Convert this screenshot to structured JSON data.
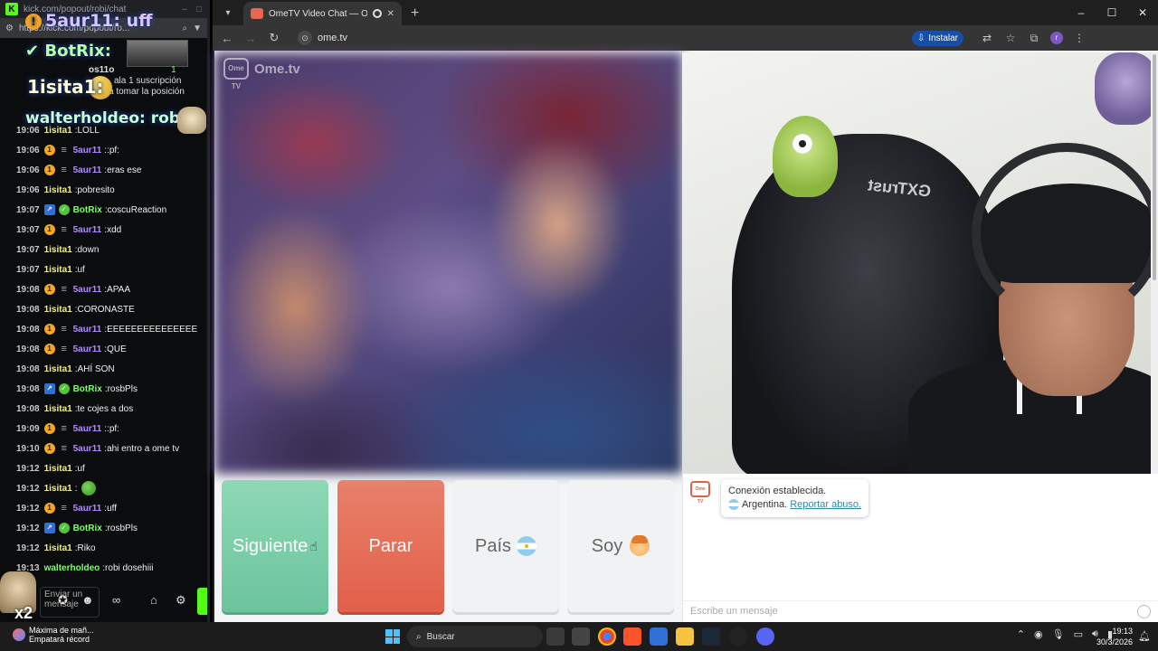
{
  "kick": {
    "tab_title": "kick.com/popout/robi/chat",
    "url": "https://kick.com/popout/ro...",
    "overlay_top_user": "5aur11",
    "overlay_top_text": "uff",
    "overlay_bot": "BotRix:",
    "overlay_lisita": "1isita1:",
    "overlay_walter": "walterholdeo: robi",
    "sub_user": "5aur11",
    "sub_user2": "os11o",
    "sub_count": "1",
    "sub_line1": "ala 1 suscripción",
    "sub_line2": "a tomar la posición",
    "messages": [
      {
        "time": "19:06",
        "badges": [],
        "user": "1isita1",
        "color": "#f3ef8f",
        "text": "LOLL"
      },
      {
        "time": "19:06",
        "badges": [
          "coin",
          "sub"
        ],
        "user": "5aur11",
        "color": "#b38bff",
        "text": ":pf:"
      },
      {
        "time": "19:06",
        "badges": [
          "coin",
          "sub"
        ],
        "user": "5aur11",
        "color": "#b38bff",
        "text": "eras ese"
      },
      {
        "time": "19:06",
        "badges": [],
        "user": "1isita1",
        "color": "#f3ef8f",
        "text": "pobresito"
      },
      {
        "time": "19:07",
        "badges": [
          "bot",
          "ver"
        ],
        "user": "BotRix",
        "color": "#7dff6b",
        "text": "coscuReaction"
      },
      {
        "time": "19:07",
        "badges": [
          "coin",
          "sub"
        ],
        "user": "5aur11",
        "color": "#b38bff",
        "text": "xdd"
      },
      {
        "time": "19:07",
        "badges": [],
        "user": "1isita1",
        "color": "#f3ef8f",
        "text": "down"
      },
      {
        "time": "19:07",
        "badges": [],
        "user": "1isita1",
        "color": "#f3ef8f",
        "text": "uf"
      },
      {
        "time": "19:08",
        "badges": [
          "coin",
          "sub"
        ],
        "user": "5aur11",
        "color": "#b38bff",
        "text": "APAA"
      },
      {
        "time": "19:08",
        "badges": [],
        "user": "1isita1",
        "color": "#f3ef8f",
        "text": "CORONASTE"
      },
      {
        "time": "19:08",
        "badges": [
          "coin",
          "sub"
        ],
        "user": "5aur11",
        "color": "#b38bff",
        "text": "EEEEEEEEEEEEEEE"
      },
      {
        "time": "19:08",
        "badges": [
          "coin",
          "sub"
        ],
        "user": "5aur11",
        "color": "#b38bff",
        "text": "QUE"
      },
      {
        "time": "19:08",
        "badges": [],
        "user": "1isita1",
        "color": "#f3ef8f",
        "text": "AHÍ SON"
      },
      {
        "time": "19:08",
        "badges": [
          "bot",
          "ver"
        ],
        "user": "BotRix",
        "color": "#7dff6b",
        "text": "rosbPls"
      },
      {
        "time": "19:08",
        "badges": [],
        "user": "1isita1",
        "color": "#f3ef8f",
        "text": "te cojes a dos"
      },
      {
        "time": "19:09",
        "badges": [
          "coin",
          "sub"
        ],
        "user": "5aur11",
        "color": "#b38bff",
        "text": ":pf:"
      },
      {
        "time": "19:10",
        "badges": [
          "coin",
          "sub"
        ],
        "user": "5aur11",
        "color": "#b38bff",
        "text": "ahi entro a ome tv"
      },
      {
        "time": "19:12",
        "badges": [],
        "user": "1isita1",
        "color": "#f3ef8f",
        "text": "uf"
      },
      {
        "time": "19:12",
        "badges": [],
        "user": "1isita1",
        "color": "#f3ef8f",
        "text": "",
        "emote": true
      },
      {
        "time": "19:12",
        "badges": [
          "coin",
          "sub"
        ],
        "user": "5aur11",
        "color": "#b38bff",
        "text": "uff"
      },
      {
        "time": "19:12",
        "badges": [
          "bot",
          "ver"
        ],
        "user": "BotRix",
        "color": "#7dff6b",
        "text": "rosbPls"
      },
      {
        "time": "19:12",
        "badges": [],
        "user": "1isita1",
        "color": "#f3ef8f",
        "text": "Riko"
      },
      {
        "time": "19:13",
        "badges": [],
        "user": "walterholdeo",
        "color": "#7dff6b",
        "text": "robi dosehiii"
      }
    ],
    "send_placeholder": "Enviar un mensaje",
    "multiplier": "x2"
  },
  "chrome": {
    "tab_title": "OmeTV Video Chat — Ome",
    "url": "ome.tv",
    "install_label": "Instalar",
    "profile_initial": "r"
  },
  "ome": {
    "logo_text": "Ome.tv",
    "logo_small": "Ome TV",
    "buttons": {
      "next": "Siguiente",
      "stop": "Parar",
      "country": "País",
      "gender": "Soy"
    },
    "system_message": {
      "line1": "Conexión establecida.",
      "country": "Argentina.",
      "report": "Reportar abuso."
    },
    "input_placeholder": "Escribe un mensaje",
    "cam_brand": "GXTrust"
  },
  "taskbar": {
    "weather_line1": "Máxima de mañ...",
    "weather_line2": "Empatará récord",
    "search_label": "Buscar",
    "time": "19:13",
    "date": "30/3/2026"
  },
  "colors": {
    "next": "#6bc49c",
    "stop": "#e25f49",
    "kick_green": "#53fc18",
    "chrome_accent": "#174ea6"
  }
}
